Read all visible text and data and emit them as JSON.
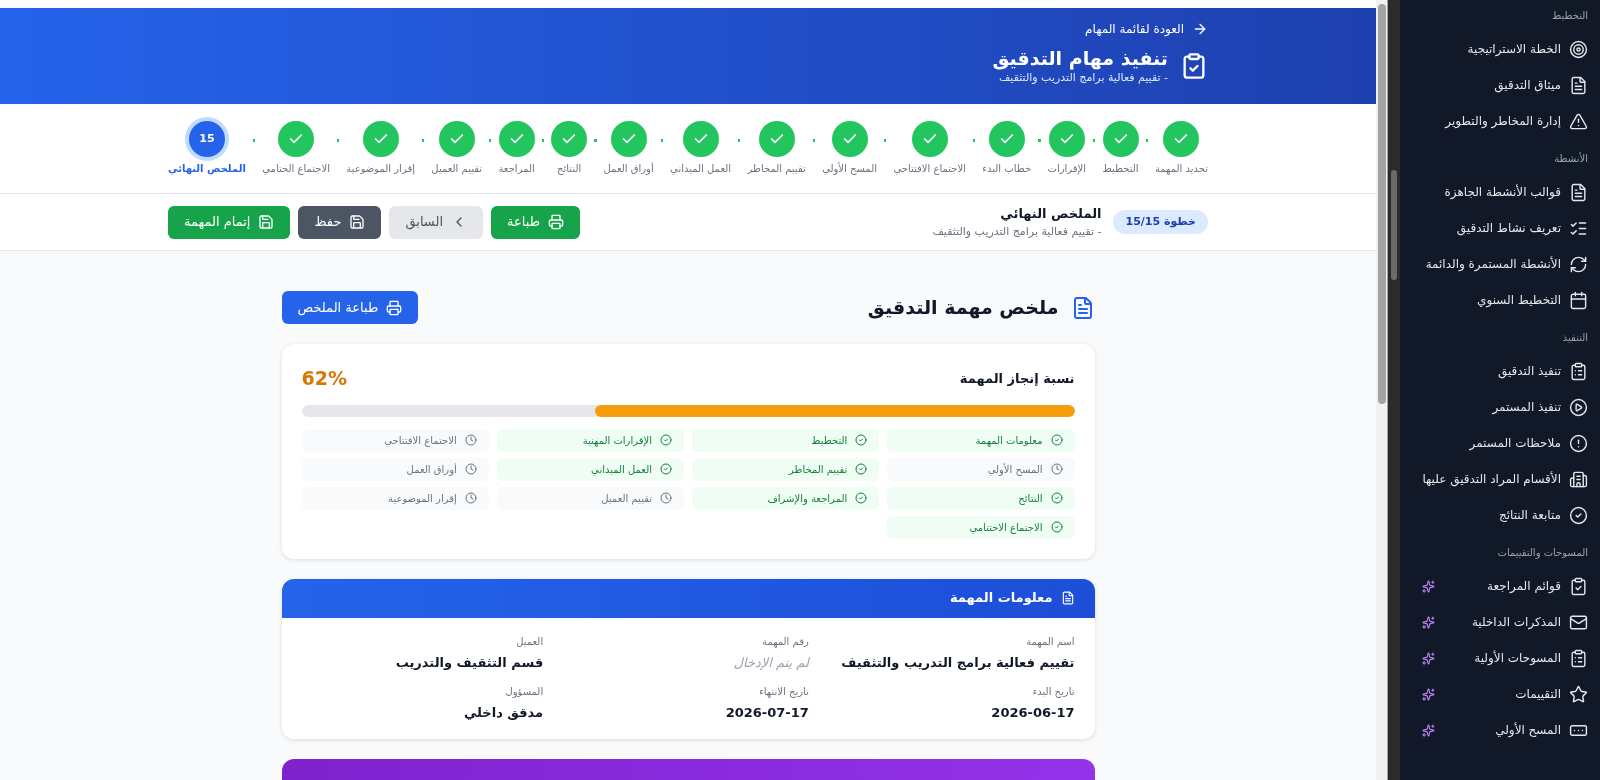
{
  "header": {
    "back_link": "العودة لقائمة المهام",
    "title": "تنفيذ مهام التدقيق",
    "subtitle": "- تقييم فعالية برامج التدريب والتثقيف"
  },
  "steps": [
    {
      "label": "تحديد المهمة",
      "kind": "done"
    },
    {
      "label": "التخطيط",
      "kind": "done"
    },
    {
      "label": "الإقرارات",
      "kind": "done"
    },
    {
      "label": "خطاب البدء",
      "kind": "done"
    },
    {
      "label": "الاجتماع الافتتاحي",
      "kind": "done"
    },
    {
      "label": "المسح الأولي",
      "kind": "done"
    },
    {
      "label": "تقييم المخاطر",
      "kind": "done"
    },
    {
      "label": "العمل الميداني",
      "kind": "done"
    },
    {
      "label": "أوراق العمل",
      "kind": "done"
    },
    {
      "label": "النتائج",
      "kind": "done"
    },
    {
      "label": "المراجعة",
      "kind": "done"
    },
    {
      "label": "تقييم العميل",
      "kind": "done"
    },
    {
      "label": "إقرار الموضوعية",
      "kind": "done"
    },
    {
      "label": "الاجتماع الختامي",
      "kind": "done"
    },
    {
      "label": "الملخص النهائي",
      "kind": "current",
      "number": "15"
    }
  ],
  "step_bar": {
    "badge": "خطوة 15/15",
    "title": "الملخص النهائي",
    "subtitle": "- تقييم فعالية برامج التدريب والتثقيف",
    "buttons": [
      {
        "label": "طباعة",
        "kind": "print"
      },
      {
        "label": "السابق",
        "kind": "previous"
      },
      {
        "label": "حفظ",
        "kind": "save"
      },
      {
        "label": "إتمام المهمة",
        "kind": "complete"
      }
    ]
  },
  "summary": {
    "title": "ملخص مهمة التدقيق",
    "print_button": "طباعة الملخص",
    "completion_label": "نسبة إنجاز المهمة",
    "percent": "62%",
    "level": 0.62,
    "sections": [
      {
        "label": "معلومات المهمة",
        "done": true
      },
      {
        "label": "التخطيط",
        "done": true
      },
      {
        "label": "الإقرارات المهنية",
        "done": true
      },
      {
        "label": "الاجتماع الافتتاحي",
        "done": false
      },
      {
        "label": "المسح الأولي",
        "done": false
      },
      {
        "label": "تقييم المخاطر",
        "done": true
      },
      {
        "label": "العمل الميداني",
        "done": true
      },
      {
        "label": "أوراق العمل",
        "done": false
      },
      {
        "label": "النتائج",
        "done": true
      },
      {
        "label": "المراجعة والإشراف",
        "done": true
      },
      {
        "label": "تقييم العميل",
        "done": false
      },
      {
        "label": "إقرار الموضوعية",
        "done": false
      },
      {
        "label": "الاجتماع الاختتامي",
        "done": true
      }
    ]
  },
  "task_info": {
    "title": "معلومات المهمة",
    "fields": [
      {
        "label": "اسم المهمة",
        "value": "تقييم فعالية برامج التدريب والتثقيف",
        "empty": false
      },
      {
        "label": "رقم المهمة",
        "value": "لم يتم الإدخال",
        "empty": true
      },
      {
        "label": "العميل",
        "value": "قسم التثقيف والتدريب",
        "empty": false
      },
      {
        "label": "تاريخ البدء",
        "value": "2026-06-17",
        "empty": false
      },
      {
        "label": "تاريخ الانتهاء",
        "value": "2026-07-17",
        "empty": false
      },
      {
        "label": "المسؤول",
        "value": "مدقق داخلي",
        "empty": false
      }
    ]
  },
  "sidebar": {
    "sections": [
      {
        "title": "التخطيط",
        "items": [
          {
            "label": "الخطة الاستراتيجية",
            "kind": "target",
            "sparkle": false
          },
          {
            "label": "ميثاق التدقيق",
            "kind": "document",
            "sparkle": false
          },
          {
            "label": "إدارة المخاطر والتطوير",
            "kind": "warning",
            "sparkle": false
          }
        ]
      },
      {
        "title": "الأنشطة",
        "items": [
          {
            "label": "قوالب الأنشطة الجاهزة",
            "kind": "document",
            "sparkle": false
          },
          {
            "label": "تعريف نشاط التدقيق",
            "kind": "checklist",
            "sparkle": false
          },
          {
            "label": "الأنشطة المستمرة والدائمة",
            "kind": "refresh",
            "sparkle": false
          },
          {
            "label": "التخطيط السنوي",
            "kind": "calendar",
            "sparkle": false
          }
        ]
      },
      {
        "title": "التنفيذ",
        "items": [
          {
            "label": "تنفيذ التدقيق",
            "kind": "clipboard",
            "sparkle": false
          },
          {
            "label": "تنفيذ المستمر",
            "kind": "play",
            "sparkle": false
          },
          {
            "label": "ملاحظات المستمر",
            "kind": "alert",
            "sparkle": false
          },
          {
            "label": "الأقسام المراد التدقيق عليها",
            "kind": "building",
            "sparkle": false
          },
          {
            "label": "متابعة النتائج",
            "kind": "check",
            "sparkle": false
          }
        ]
      },
      {
        "title": "المسوحات والتقييمات",
        "items": [
          {
            "label": "قوائم المراجعة",
            "kind": "checklist-board",
            "sparkle": true
          },
          {
            "label": "المذكرات الداخلية",
            "kind": "mail",
            "sparkle": true
          },
          {
            "label": "المسوحات الأولية",
            "kind": "clipboard",
            "sparkle": true
          },
          {
            "label": "التقييمات",
            "kind": "star",
            "sparkle": true
          },
          {
            "label": "المسح الأولي",
            "kind": "form",
            "sparkle": true
          }
        ]
      }
    ]
  }
}
